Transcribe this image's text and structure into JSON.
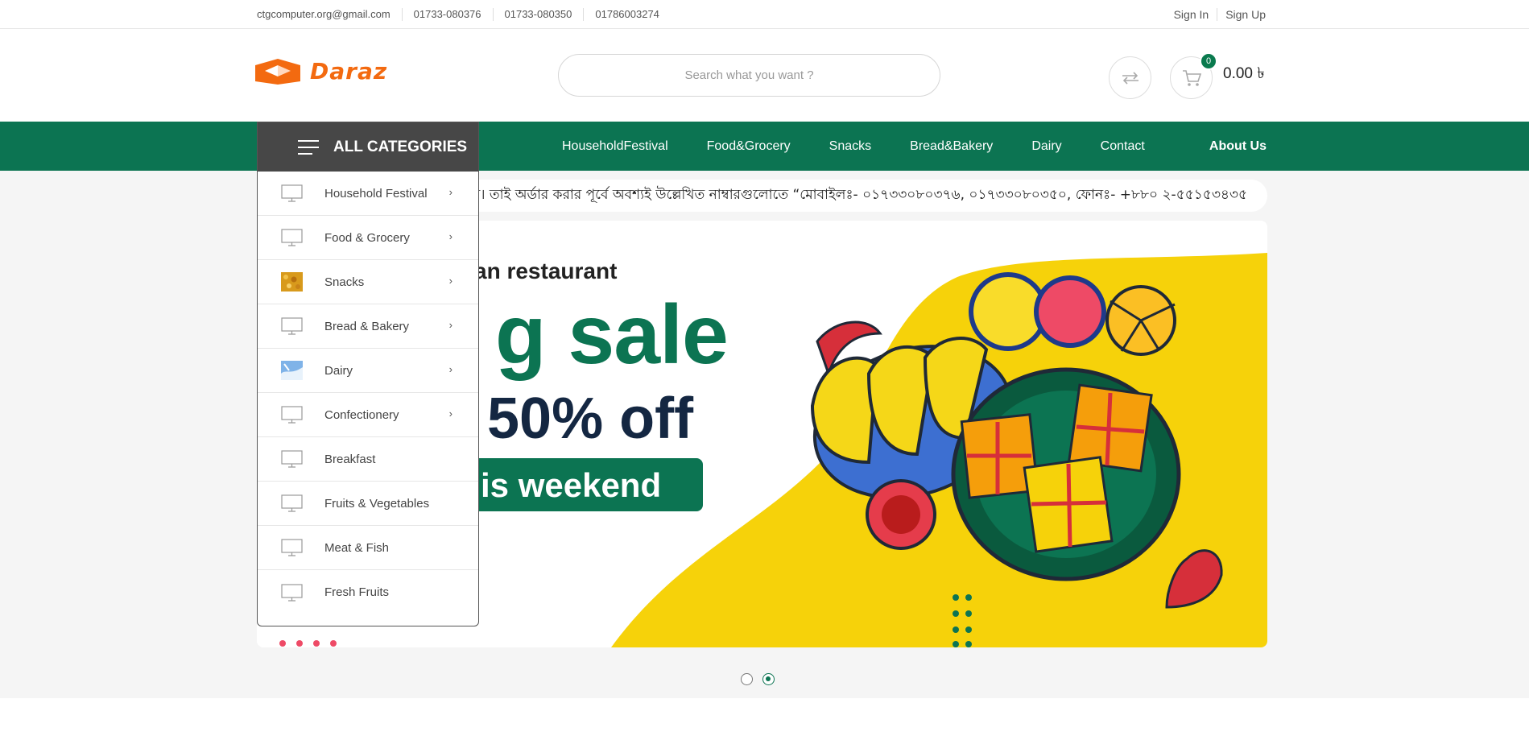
{
  "topbar": {
    "email": "ctgcomputer.org@gmail.com",
    "phones": [
      "01733-080376",
      "01733-080350",
      "01786003274"
    ],
    "sign_in": "Sign In",
    "sign_up": "Sign Up"
  },
  "header": {
    "logo_text": "Daraz",
    "search_placeholder": "Search what you want ?",
    "cart_count": "0",
    "cart_total": "0.00 ৳",
    "icons": [
      "compare-icon",
      "cart-icon"
    ]
  },
  "nav": {
    "all_categories": "ALL CATEGORIES",
    "links": [
      "HouseholdFestival",
      "Food&Grocery",
      "Snacks",
      "Bread&Bakery",
      "Dairy",
      "Contact"
    ],
    "about": "About Us"
  },
  "categories": [
    {
      "label": "Household Festival",
      "icon": "monitor-icon",
      "has_sub": true
    },
    {
      "label": "Food & Grocery",
      "icon": "monitor-icon",
      "has_sub": true
    },
    {
      "label": "Snacks",
      "icon": "snacks-thumbnail",
      "has_sub": true
    },
    {
      "label": "Bread & Bakery",
      "icon": "monitor-icon",
      "has_sub": true
    },
    {
      "label": "Dairy",
      "icon": "dairy-thumbnail",
      "has_sub": true
    },
    {
      "label": "Confectionery",
      "icon": "monitor-icon",
      "has_sub": true
    },
    {
      "label": "Breakfast",
      "icon": "monitor-icon",
      "has_sub": false
    },
    {
      "label": "Fruits & Vegetables",
      "icon": "monitor-icon",
      "has_sub": false
    },
    {
      "label": "Meat & Fish",
      "icon": "monitor-icon",
      "has_sub": false
    },
    {
      "label": "Fresh Fruits",
      "icon": "monitor-icon",
      "has_sub": false
    }
  ],
  "chevron": "›",
  "marquee": "র। তাই অর্ডার করার পূর্বে অবশ্যই উল্লেখিত নাম্বারগুলোতে “মোবাইলঃ- ০১৭৩৩০৮০৩৭৬, ০১৭৩৩০৮০৩৫০, ফোনঃ- +৮৮০ ২-৫৫১৫৩৪৩৫",
  "banner": {
    "line1": "an restaurant",
    "line2": "g sale",
    "line3": "50% off",
    "line4": "is weekend"
  },
  "slider": {
    "dots": 2,
    "active": 2
  },
  "colors": {
    "brand_green": "#0c7452",
    "logo_orange": "#f36a10",
    "category_header": "#474747",
    "banner_yellow": "#f6d20a"
  }
}
